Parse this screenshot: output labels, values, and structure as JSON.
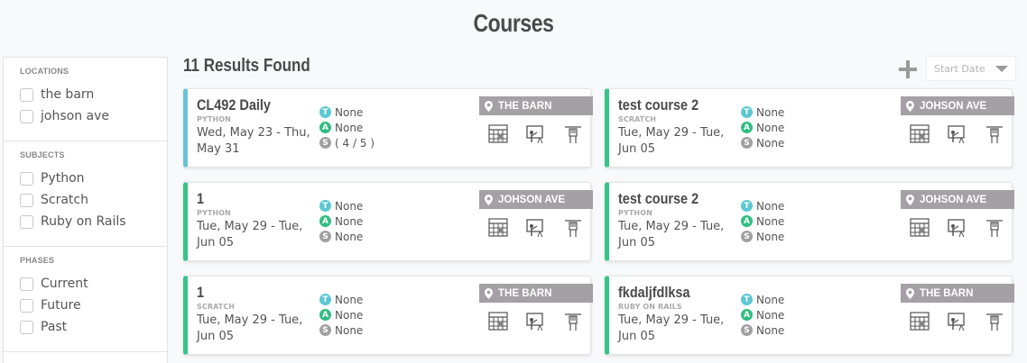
{
  "page": {
    "title": "Courses"
  },
  "sidebar": {
    "groups": [
      {
        "heading": "LOCATIONS",
        "options": [
          "the barn",
          "johson ave"
        ]
      },
      {
        "heading": "SUBJECTS",
        "options": [
          "Python",
          "Scratch",
          "Ruby on Rails"
        ]
      },
      {
        "heading": "PHASES",
        "options": [
          "Current",
          "Future",
          "Past"
        ]
      }
    ]
  },
  "results": {
    "count_label": "11 Results Found",
    "sort_placeholder": "Start Date"
  },
  "colors": {
    "teacher": "#5bc8d4",
    "assistant": "#2fbf82",
    "students": "#a0a0a0",
    "accent_current": "#6cc3d5",
    "accent_future": "#36c487",
    "location_banner": "#a59fa6"
  },
  "role_letters": {
    "teacher": "T",
    "assistant": "A",
    "students": "S"
  },
  "card_icons": [
    "calendar-grid-icon",
    "presentation-board-icon",
    "hand-raise-icon"
  ],
  "cards": [
    {
      "title": "CL492 Daily",
      "subject": "PYTHON",
      "dates": "Wed, May 23 - Thu, May 31",
      "teacher": "None",
      "assistant": "None",
      "students": "( 4 / 5 )",
      "location": "THE BARN"
    },
    {
      "title": "test course 2",
      "subject": "SCRATCH",
      "dates": "Tue, May 29 - Tue, Jun 05",
      "teacher": "None",
      "assistant": "None",
      "students": "None",
      "location": "JOHSON AVE"
    },
    {
      "title": "1",
      "subject": "PYTHON",
      "dates": "Tue, May 29 - Tue, Jun 05",
      "teacher": "None",
      "assistant": "None",
      "students": "None",
      "location": "JOHSON AVE"
    },
    {
      "title": "test course 2",
      "subject": "PYTHON",
      "dates": "Tue, May 29 - Tue, Jun 05",
      "teacher": "None",
      "assistant": "None",
      "students": "None",
      "location": "JOHSON AVE"
    },
    {
      "title": "1",
      "subject": "SCRATCH",
      "dates": "Tue, May 29 - Tue, Jun 05",
      "teacher": "None",
      "assistant": "None",
      "students": "None",
      "location": "THE BARN"
    },
    {
      "title": "fkdaljfdlksa",
      "subject": "RUBY ON RAILS",
      "dates": "Tue, May 29 - Tue, Jun 05",
      "teacher": "None",
      "assistant": "None",
      "students": "None",
      "location": "THE BARN"
    }
  ]
}
